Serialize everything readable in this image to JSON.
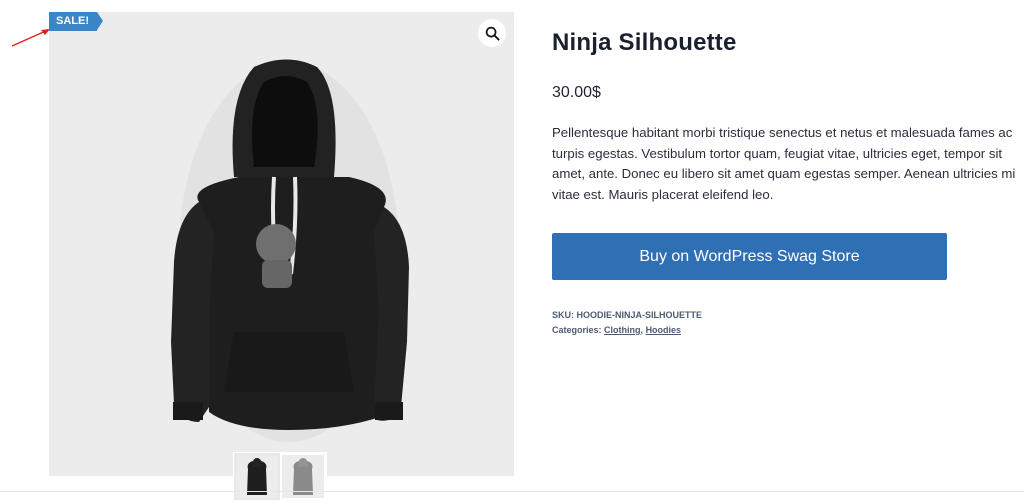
{
  "gallery": {
    "sale_badge": "SALE!",
    "zoom_icon": "magnifier-icon",
    "image_alt": "Black hoodie with ninja silhouette print",
    "thumbnails": [
      "black-hoodie-thumbnail",
      "grey-hoodie-thumbnail"
    ]
  },
  "product": {
    "title": "Ninja Silhouette",
    "price": "30.00$",
    "description": "Pellentesque habitant morbi tristique senectus et netus et malesuada fames ac turpis egestas. Vestibulum tortor quam, feugiat vitae, ultricies eget, tempor sit amet, ante. Donec eu libero sit amet quam egestas semper. Aenean ultricies mi vitae est. Mauris placerat eleifend leo.",
    "buy_button": "Buy on WordPress Swag Store"
  },
  "meta": {
    "sku_label": "SKU:",
    "sku": "HOODIE-NINJA-SILHOUETTE",
    "categories_label": "Categories:",
    "categories": [
      "Clothing",
      "Hoodies"
    ],
    "separator": ","
  },
  "colors": {
    "badge": "#3b86c8",
    "button": "#2f6fb3",
    "annotation": "#e0201b"
  }
}
